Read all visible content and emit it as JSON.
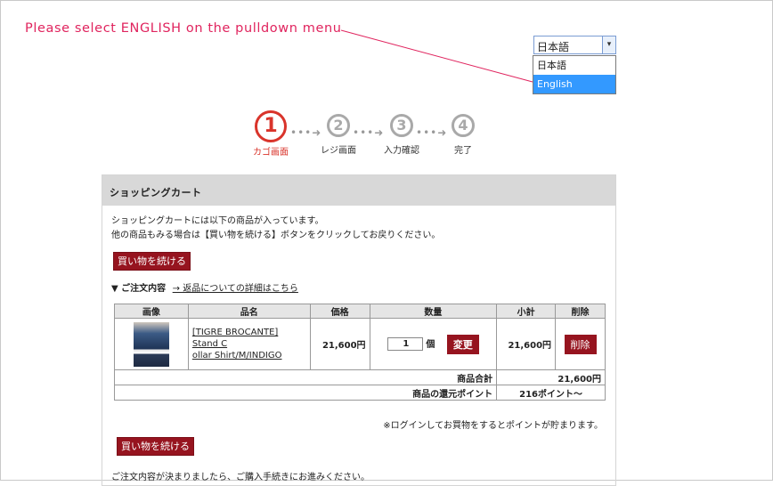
{
  "annotation": {
    "text": "Please select ENGLISH on the pulldown menu"
  },
  "language": {
    "selected": "日本語",
    "arrow_glyph": "▾",
    "options": [
      {
        "label": "日本語",
        "selected": false
      },
      {
        "label": "English",
        "selected": true
      }
    ]
  },
  "steps": [
    {
      "number": "1",
      "label": "カゴ画面",
      "active": true
    },
    {
      "number": "2",
      "label": "レジ画面",
      "active": false
    },
    {
      "number": "3",
      "label": "入力確認",
      "active": false
    },
    {
      "number": "4",
      "label": "完了",
      "active": false
    }
  ],
  "cart": {
    "title": "ショッピングカート",
    "intro_line1": "ショッピングカートには以下の商品が入っています。",
    "intro_line2": "他の商品もみる場合は【買い物を続ける】ボタンをクリックしてお戻りください。",
    "continue_label": "買い物を続ける",
    "order_title": "▼ ご注文内容",
    "return_link": "→ 返品についての詳細はこちら",
    "columns": [
      "画像",
      "品名",
      "価格",
      "数量",
      "小計",
      "削除"
    ],
    "item": {
      "name_line1": "[TIGRE BROCANTE] Stand C",
      "name_line2": "ollar Shirt/M/INDIGO",
      "price": "21,600円",
      "qty": "1",
      "qty_unit": "個",
      "change_label": "変更",
      "subtotal": "21,600円",
      "delete_label": "削除"
    },
    "total_label": "商品合計",
    "total_value": "21,600円",
    "points_label": "商品の還元ポイント",
    "points_value": "216ポイント～",
    "login_note": "※ログインしてお買物をするとポイントが貯まります。",
    "continue_label_2": "買い物を続ける",
    "footer": "ご注文内容が決まりましたら、ご購入手続きにお進みください。"
  },
  "colors": {
    "accent": "#96141f",
    "annotation": "#e0245e",
    "active_step": "#d9342b"
  }
}
